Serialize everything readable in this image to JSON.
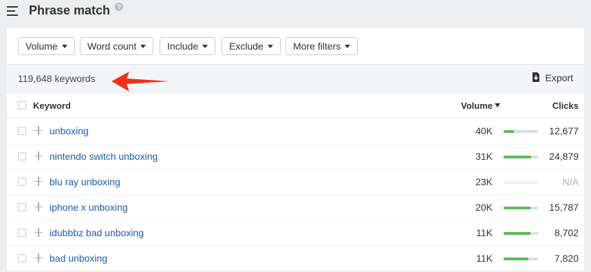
{
  "header": {
    "title": "Phrase match",
    "help_icon": "?"
  },
  "filters": [
    {
      "label": "Volume"
    },
    {
      "label": "Word count"
    },
    {
      "label": "Include"
    },
    {
      "label": "Exclude"
    },
    {
      "label": "More filters"
    }
  ],
  "summary": {
    "keyword_count": "119,648 keywords",
    "export_label": "Export"
  },
  "table": {
    "columns": {
      "keyword": "Keyword",
      "volume": "Volume",
      "clicks": "Clicks"
    },
    "rows": [
      {
        "keyword": "unboxing",
        "volume": "40K",
        "clicks": "12,677",
        "clicks_share": 0.3
      },
      {
        "keyword": "nintendo switch unboxing",
        "volume": "31K",
        "clicks": "24,879",
        "clicks_share": 0.8
      },
      {
        "keyword": "blu ray unboxing",
        "volume": "23K",
        "clicks": "N/A",
        "clicks_share": null
      },
      {
        "keyword": "iphone x unboxing",
        "volume": "20K",
        "clicks": "15,787",
        "clicks_share": 0.78
      },
      {
        "keyword": "idubbbz bad unboxing",
        "volume": "11K",
        "clicks": "8,702",
        "clicks_share": 0.78
      },
      {
        "keyword": "bad unboxing",
        "volume": "11K",
        "clicks": "7,820",
        "clicks_share": 0.72
      }
    ]
  },
  "colors": {
    "accent_link": "#1d5ba8",
    "bar_fill": "#5fb85c",
    "annotation_arrow": "#f0301a"
  }
}
